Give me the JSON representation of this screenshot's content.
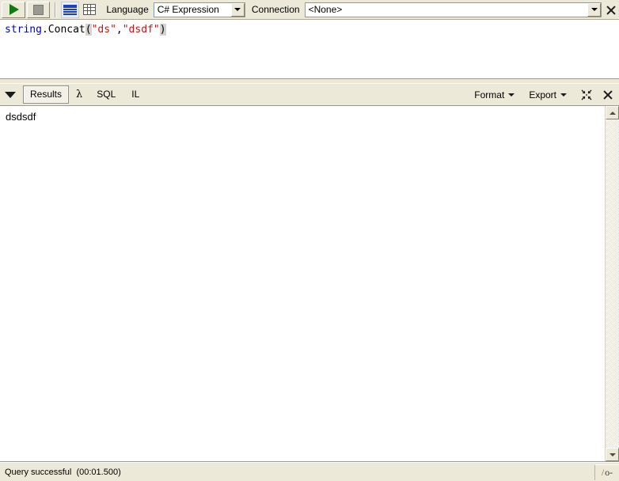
{
  "toolbar": {
    "run_button": "run-query",
    "stop_button": "stop-query",
    "view_text_icon": "text-view-icon",
    "view_grid_icon": "grid-view-icon",
    "language_label": "Language",
    "language_value": "C# Expression",
    "connection_label": "Connection",
    "connection_value": "<None>",
    "close_label": "close-icon"
  },
  "editor": {
    "code": {
      "segment1": "string",
      "segment2": ".Concat",
      "open_paren": "(",
      "string1": "\"ds\"",
      "comma": ",",
      "string2": "\"dsdf\"",
      "close_paren": ")"
    },
    "full_text": "string.Concat(\"ds\",\"dsdf\")"
  },
  "results_bar": {
    "collapse_icon": "collapse-triangle-icon",
    "tabs": [
      {
        "label": "Results",
        "selected": true
      },
      {
        "label": "λ",
        "selected": false
      },
      {
        "label": "SQL",
        "selected": false
      },
      {
        "label": "IL",
        "selected": false
      }
    ],
    "format_label": "Format",
    "export_label": "Export",
    "shrink_icon": "shrink-arrows-icon",
    "close_icon": "close-icon"
  },
  "results": {
    "output": "dsdsdf"
  },
  "statusbar": {
    "message": "Query successful  (00:01.500)",
    "grip_label": "/o-"
  },
  "colors": {
    "chrome": "#ece9d8",
    "keyword": "#0000c8",
    "string": "#c81414",
    "run_green": "#127a12",
    "bracket_highlight": "#d6d3ce"
  }
}
